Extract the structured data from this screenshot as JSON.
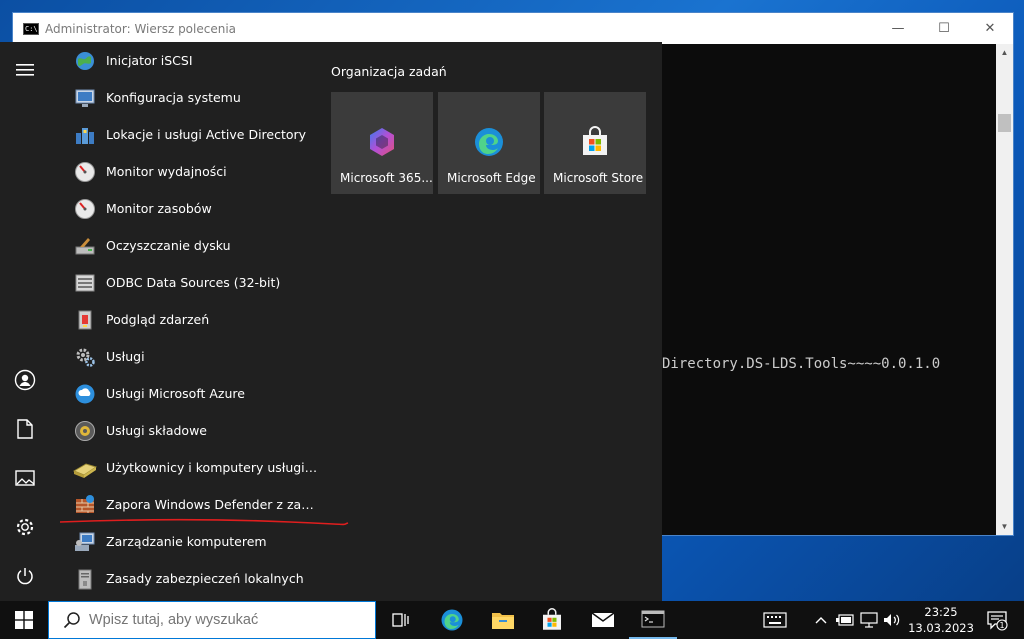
{
  "cmd_window": {
    "icon_text": "C:\\",
    "title": "Administrator: Wiersz polecenia",
    "minimize": "—",
    "maximize": "☐",
    "close": "✕",
    "output_line": "Directory.DS-LDS.Tools~~~~0.0.1.0"
  },
  "start_menu": {
    "rail": [
      "menu-icon",
      "user-icon",
      "documents-icon",
      "pictures-icon",
      "settings-icon",
      "power-icon"
    ],
    "apps": [
      {
        "label": "Inicjator iSCSI",
        "icon": "globe-icon"
      },
      {
        "label": "Konfiguracja systemu",
        "icon": "system-config-icon"
      },
      {
        "label": "Lokacje i usługi Active Directory",
        "icon": "ad-sites-icon"
      },
      {
        "label": "Monitor wydajności",
        "icon": "performance-monitor-icon"
      },
      {
        "label": "Monitor zasobów",
        "icon": "resource-monitor-icon"
      },
      {
        "label": "Oczyszczanie dysku",
        "icon": "disk-cleanup-icon"
      },
      {
        "label": "ODBC Data Sources (32-bit)",
        "icon": "odbc-icon"
      },
      {
        "label": "Podgląd zdarzeń",
        "icon": "event-viewer-icon"
      },
      {
        "label": "Usługi",
        "icon": "services-gear-icon"
      },
      {
        "label": "Usługi Microsoft Azure",
        "icon": "azure-icon"
      },
      {
        "label": "Usługi składowe",
        "icon": "component-services-icon"
      },
      {
        "label": "Użytkownicy i komputery usługi Active Directory",
        "icon": "ad-users-computers-icon"
      },
      {
        "label": "Zapora Windows Defender z zabezpieczeniami zaawansowanymi",
        "icon": "firewall-icon"
      },
      {
        "label": "Zarządzanie komputerem",
        "icon": "computer-management-icon"
      },
      {
        "label": "Zasady zabezpieczeń lokalnych",
        "icon": "local-security-policy-icon"
      }
    ],
    "group_title": "Organizacja zadań",
    "tiles": [
      {
        "label": "Microsoft 365...",
        "icon": "m365-icon"
      },
      {
        "label": "Microsoft Edge",
        "icon": "edge-icon"
      },
      {
        "label": "Microsoft Store",
        "icon": "store-icon"
      }
    ]
  },
  "taskbar": {
    "search_placeholder": "Wpisz tutaj, aby wyszukać",
    "pinned": [
      "task-view-icon",
      "edge-icon",
      "file-explorer-icon",
      "store-icon",
      "mail-icon",
      "cmd-icon"
    ],
    "tray": [
      "keyboard-icon",
      "chevron-up-icon",
      "battery-icon",
      "network-icon",
      "volume-icon"
    ],
    "time": "23:25",
    "date": "13.03.2023",
    "notification_count": "1"
  },
  "colors": {
    "start_bg": "#202020",
    "tile_bg": "#3b3b3b",
    "taskbar_bg": "#101010",
    "accent": "#0078d7",
    "annotation": "#e01e1e"
  }
}
